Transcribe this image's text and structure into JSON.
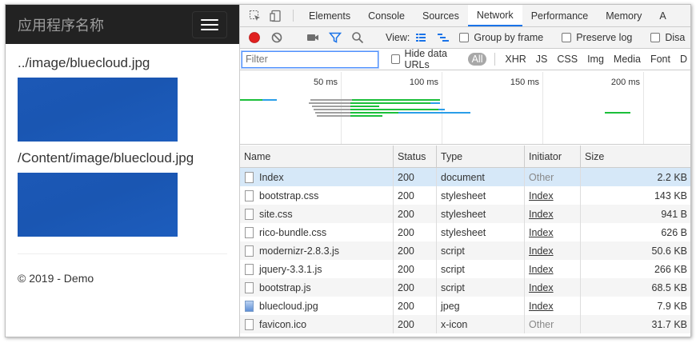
{
  "page": {
    "brand": "应用程序名称",
    "image1_path": "../image/bluecloud.jpg",
    "image2_path": "/Content/image/bluecloud.jpg",
    "footer": "© 2019 - Demo"
  },
  "devtools": {
    "tabs": [
      "Elements",
      "Console",
      "Sources",
      "Network",
      "Performance",
      "Memory",
      "A"
    ],
    "active_tab": "Network",
    "toolbar": {
      "view_label": "View:",
      "group_by_frame": "Group by frame",
      "preserve_log": "Preserve log",
      "disable_cache": "Disa"
    },
    "filter": {
      "placeholder": "Filter",
      "hide_data_urls": "Hide data URLs",
      "types": [
        "All",
        "XHR",
        "JS",
        "CSS",
        "Img",
        "Media",
        "Font",
        "D"
      ]
    },
    "overview_ticks": [
      "50 ms",
      "100 ms",
      "150 ms",
      "200 ms"
    ],
    "columns": [
      "Name",
      "Status",
      "Type",
      "Initiator",
      "Size"
    ],
    "rows": [
      {
        "name": "Index",
        "status": "200",
        "type": "document",
        "initiator": "Other",
        "size": "2.2 KB",
        "icon": "file-icon"
      },
      {
        "name": "bootstrap.css",
        "status": "200",
        "type": "stylesheet",
        "initiator": "Index",
        "size": "143 KB",
        "icon": "file-icon"
      },
      {
        "name": "site.css",
        "status": "200",
        "type": "stylesheet",
        "initiator": "Index",
        "size": "941 B",
        "icon": "file-icon"
      },
      {
        "name": "rico-bundle.css",
        "status": "200",
        "type": "stylesheet",
        "initiator": "Index",
        "size": "626 B",
        "icon": "file-icon"
      },
      {
        "name": "modernizr-2.8.3.js",
        "status": "200",
        "type": "script",
        "initiator": "Index",
        "size": "50.6 KB",
        "icon": "file-icon"
      },
      {
        "name": "jquery-3.3.1.js",
        "status": "200",
        "type": "script",
        "initiator": "Index",
        "size": "266 KB",
        "icon": "file-icon"
      },
      {
        "name": "bootstrap.js",
        "status": "200",
        "type": "script",
        "initiator": "Index",
        "size": "68.5 KB",
        "icon": "file-icon"
      },
      {
        "name": "bluecloud.jpg",
        "status": "200",
        "type": "jpeg",
        "initiator": "Index",
        "size": "7.9 KB",
        "icon": "image-file-icon"
      },
      {
        "name": "favicon.ico",
        "status": "200",
        "type": "x-icon",
        "initiator": "Other",
        "size": "31.7 KB",
        "icon": "file-icon"
      }
    ]
  },
  "colors": {
    "navbar_bg": "#222222",
    "cloud_blue": "#1c58b6",
    "record_red": "#e0201f",
    "accent_blue": "#1a73e8",
    "waterfall_green": "#1bbf3a",
    "waterfall_blue": "#2a9ee8"
  }
}
